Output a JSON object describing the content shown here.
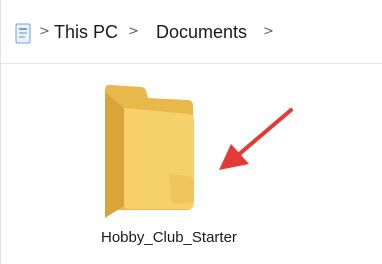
{
  "breadcrumb": {
    "items": [
      {
        "label": "This PC"
      },
      {
        "label": "Documents"
      }
    ],
    "separator": ">",
    "location_icon": "pc-location-icon"
  },
  "folder": {
    "name": "Hobby_Club_Starter",
    "icon": "folder-icon",
    "color": "#f3c95c"
  },
  "annotation": {
    "icon": "red-arrow-icon",
    "color": "#e53935"
  }
}
